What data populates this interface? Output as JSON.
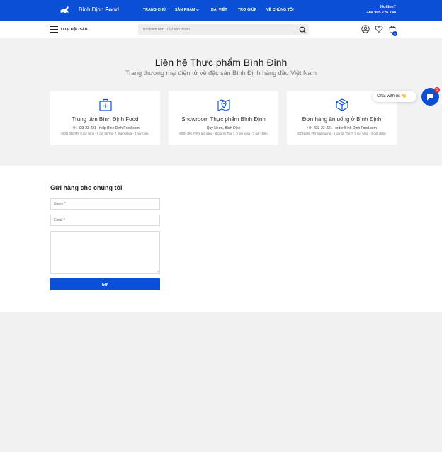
{
  "header": {
    "logo_text": "Bình Định",
    "logo_text_bold": "Food",
    "nav": [
      "TRANG CHỦ",
      "SẢN PHẨM",
      "BÀI VIẾT",
      "TRỢ GIÚP",
      "VỀ CHÚNG TÔI"
    ],
    "hotline_label": "Hotline?",
    "hotline_number": "+84 905.726.748"
  },
  "subheader": {
    "menu_label": "LOẠI ĐẶC SẢN",
    "search_placeholder": "Tìm kiếm hơn 1000 sản phẩm",
    "cart_count": "0"
  },
  "contact": {
    "title": "Liên hệ Thực phẩm Bình Định",
    "subtitle": "Trang thương mại điện tử về đặc sản Bình Định hàng đầu Việt Nam",
    "cards": [
      {
        "icon": "medical-kit-icon",
        "title": "Trung tâm Bình Định Food",
        "line1": "+94 423-23-221 · help Bình Định Food.com",
        "line2": "MON đến FRI 9 giờ sáng - 6 giờ tối Thứ 7, 9 giờ sáng - 2 giờ chiều"
      },
      {
        "icon": "map-pin-icon",
        "title": "Showroom Thực phẩm Bình Định",
        "line1": "Quy Nhơn, Bình Định",
        "line2": "MON đến FRI 9 giờ sáng - 6 giờ tối Thứ 7, 9 giờ sáng - 2 giờ chiều"
      },
      {
        "icon": "box-icon",
        "title": "Đơn hàng ăn uống ở Bình Định",
        "line1": "+94 423-23-221 · order Bình Định Food.com",
        "line2": "MON đến FRI 9 giờ sáng - 6 giờ tối Thứ 7, 9 giờ sáng - 2 giờ chiều"
      }
    ]
  },
  "chat": {
    "label": "Chat with us 👋",
    "badge": "1"
  },
  "form": {
    "title": "Gửi hàng cho chúng tôi",
    "name_placeholder": "Name *",
    "email_placeholder": "Email *",
    "message_placeholder": "",
    "submit_label": "Gửi"
  },
  "colors": {
    "brand_blue": "#0a4fd6",
    "badge_red": "#e8262b"
  }
}
